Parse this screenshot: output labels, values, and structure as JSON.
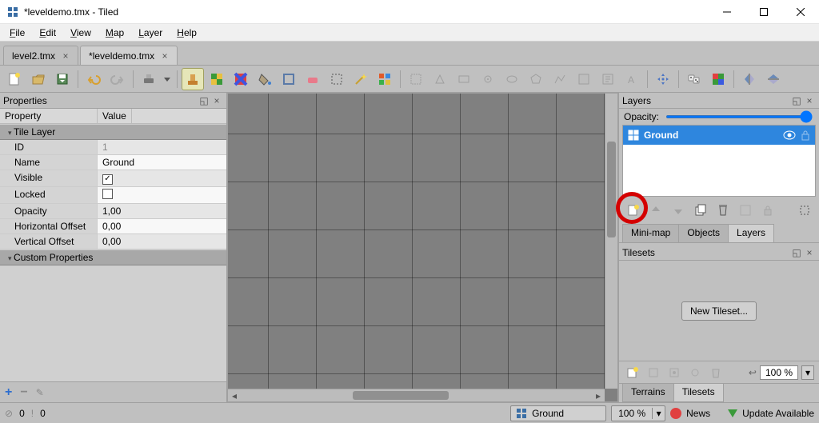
{
  "window": {
    "title": "*leveldemo.tmx - Tiled"
  },
  "menus": [
    "File",
    "Edit",
    "View",
    "Map",
    "Layer",
    "Help"
  ],
  "tabs": [
    {
      "label": "level2.tmx",
      "active": false
    },
    {
      "label": "*leveldemo.tmx",
      "active": true
    }
  ],
  "properties": {
    "title": "Properties",
    "head_key": "Property",
    "head_val": "Value",
    "section1": "Tile Layer",
    "rows": [
      {
        "k": "ID",
        "v": "1",
        "dim": true
      },
      {
        "k": "Name",
        "v": "Ground"
      },
      {
        "k": "Visible",
        "v": "check"
      },
      {
        "k": "Locked",
        "v": "uncheck"
      },
      {
        "k": "Opacity",
        "v": "1,00"
      },
      {
        "k": "Horizontal Offset",
        "v": "0,00"
      },
      {
        "k": "Vertical Offset",
        "v": "0,00"
      }
    ],
    "section2": "Custom Properties"
  },
  "layers_panel": {
    "title": "Layers",
    "opacity_label": "Opacity:",
    "items": [
      {
        "name": "Ground"
      }
    ],
    "tabs": [
      "Mini-map",
      "Objects",
      "Layers"
    ],
    "active_tab": "Layers"
  },
  "tilesets_panel": {
    "title": "Tilesets",
    "new_tileset": "New Tileset...",
    "zoom": "100 %",
    "bottom_tabs": [
      "Terrains",
      "Tilesets"
    ],
    "active_bottom": "Tilesets"
  },
  "statusbar": {
    "err": "0",
    "warn": "0",
    "layer": "Ground",
    "zoom": "100 %",
    "news": "News",
    "update": "Update Available"
  }
}
